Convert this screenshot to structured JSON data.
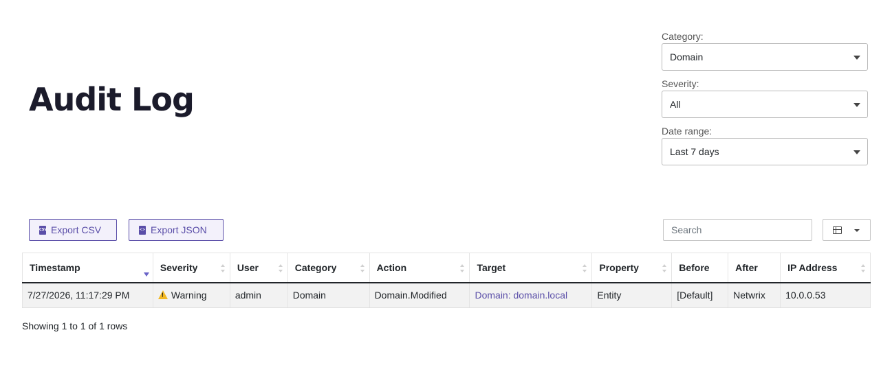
{
  "page": {
    "title": "Audit Log"
  },
  "filters": {
    "category": {
      "label": "Category:",
      "value": "Domain"
    },
    "severity": {
      "label": "Severity:",
      "value": "All"
    },
    "date_range": {
      "label": "Date range:",
      "value": "Last 7 days"
    }
  },
  "toolbar": {
    "export_csv": "Export CSV",
    "export_json": "Export JSON",
    "csv_icon_text": "CSV",
    "json_icon_text": "<>",
    "search_placeholder": "Search"
  },
  "table": {
    "columns": [
      "Timestamp",
      "Severity",
      "User",
      "Category",
      "Action",
      "Target",
      "Property",
      "Before",
      "After",
      "IP Address"
    ],
    "sorted_column": "Timestamp",
    "sort_direction": "descending",
    "rows": [
      {
        "timestamp": "7/27/2026, 11:17:29 PM",
        "severity": "Warning",
        "user": "admin",
        "category": "Domain",
        "action": "Domain.Modified",
        "target": "Domain: domain.local",
        "property": "Entity",
        "before": "[Default]",
        "after": "Netwrix",
        "ip_address": "10.0.0.53"
      }
    ]
  },
  "footer": {
    "showing": "Showing 1 to 1 of 1 rows"
  },
  "colors": {
    "accent": "#5a4ea8",
    "warning": "#f2b824",
    "title": "#1b1b2b"
  },
  "icons": {
    "export_csv": "csv-file-icon",
    "export_json": "json-file-icon",
    "columns": "table-columns-icon",
    "severity_warning": "warning-triangle-icon"
  }
}
